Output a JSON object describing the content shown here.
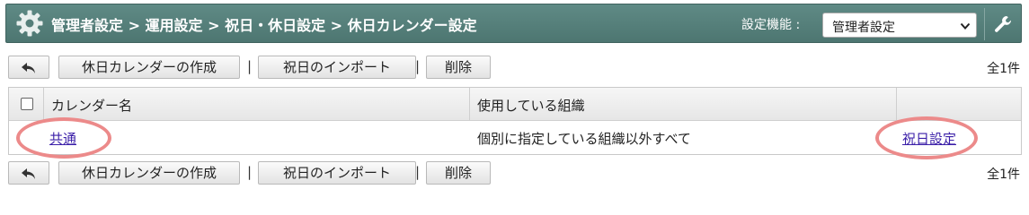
{
  "header": {
    "breadcrumb": "管理者設定 > 運用設定 > 祝日・休日設定 > 休日カレンダー設定",
    "function_label": "設定機能 :",
    "function_select_value": "管理者設定",
    "settings_icon": "gear-icon",
    "tool_icon": "wrench-icon"
  },
  "toolbar": {
    "back_icon": "back-arrow-icon",
    "create_label": "休日カレンダーの作成",
    "import_label": "祝日のインポート",
    "delete_label": "削除",
    "separator": "|",
    "total_count": "全1件"
  },
  "table": {
    "columns": [
      "カレンダー名",
      "使用している組織"
    ],
    "rows": [
      {
        "name": "共通",
        "organization": "個別に指定している組織以外すべて",
        "action": "祝日設定"
      }
    ]
  },
  "colors": {
    "header_bg": "#557e79",
    "link": "#3b1fa8",
    "annotation": "#ec8a8a"
  }
}
